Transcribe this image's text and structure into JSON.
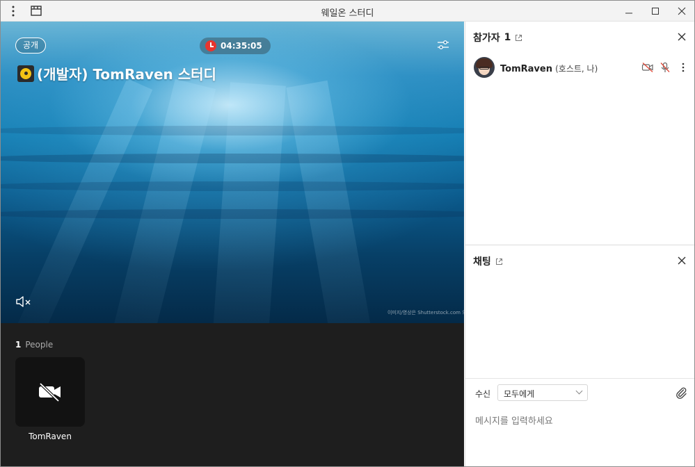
{
  "window": {
    "title": "웨일온 스터디"
  },
  "stage": {
    "visibility_badge": "공개",
    "timer": "04:35:05",
    "room_title": "(개발자) TomRaven 스터디",
    "credit": "이미지/영상은 Shutterstock.com 의 라"
  },
  "people": {
    "count": "1",
    "label": "People",
    "tiles": [
      {
        "name": "TomRaven",
        "camera": "off"
      }
    ]
  },
  "participants_panel": {
    "title": "참가자",
    "count": "1",
    "items": [
      {
        "name": "TomRaven",
        "role": "(호스트, 나)",
        "camera": "off",
        "mic": "off"
      }
    ]
  },
  "chat_panel": {
    "title": "채팅",
    "recipient_label": "수신",
    "recipient_value": "모두에게",
    "message_placeholder": "메시지를 입력하세요"
  },
  "icons": {
    "menu": "more-vert-icon",
    "layout": "layout-icon",
    "minimize": "minimize-icon",
    "maximize": "maximize-icon",
    "close": "close-icon",
    "timer": "clock-icon",
    "settings": "sliders-icon",
    "mute": "speaker-mute-icon",
    "camera_off": "camera-off-icon",
    "mic_off": "mic-off-icon",
    "external": "external-link-icon",
    "attach": "paperclip-icon"
  },
  "colors": {
    "timer_dot": "#e8352e",
    "people_bg": "#1e1e1e",
    "tile_bg": "#121212",
    "mic_off": "#e04a3a"
  }
}
